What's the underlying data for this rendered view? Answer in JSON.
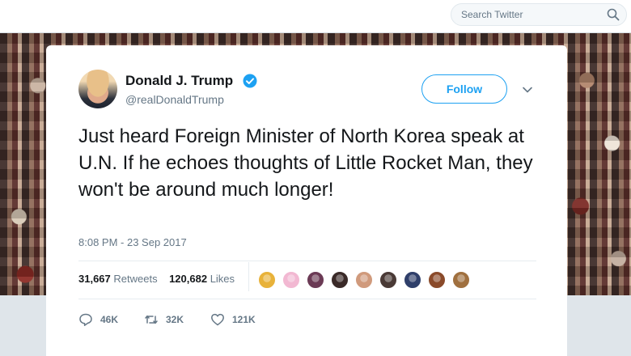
{
  "search": {
    "placeholder": "Search Twitter"
  },
  "tweet": {
    "display_name": "Donald J. Trump",
    "handle": "@realDonaldTrump",
    "follow_label": "Follow",
    "text": "Just heard Foreign Minister of North Korea speak at U.N. If he echoes thoughts of Little Rocket Man, they won't be around much longer!",
    "timestamp": "8:08 PM - 23 Sep 2017",
    "retweets": "31,667",
    "retweets_label": "Retweets",
    "likes": "120,682",
    "likes_label": "Likes",
    "liker_avatar_colors": [
      "#e8b23a",
      "#f2b8d2",
      "#6b3a55",
      "#3a2a28",
      "#d09a7c",
      "#4a3a36",
      "#2f3f6a",
      "#8a4a2a",
      "#a0703f"
    ],
    "actions": {
      "replies": "46K",
      "retweets": "32K",
      "likes": "121K"
    }
  },
  "colors": {
    "accent": "#1da1f2",
    "text": "#14171a",
    "secondary": "#657786"
  }
}
